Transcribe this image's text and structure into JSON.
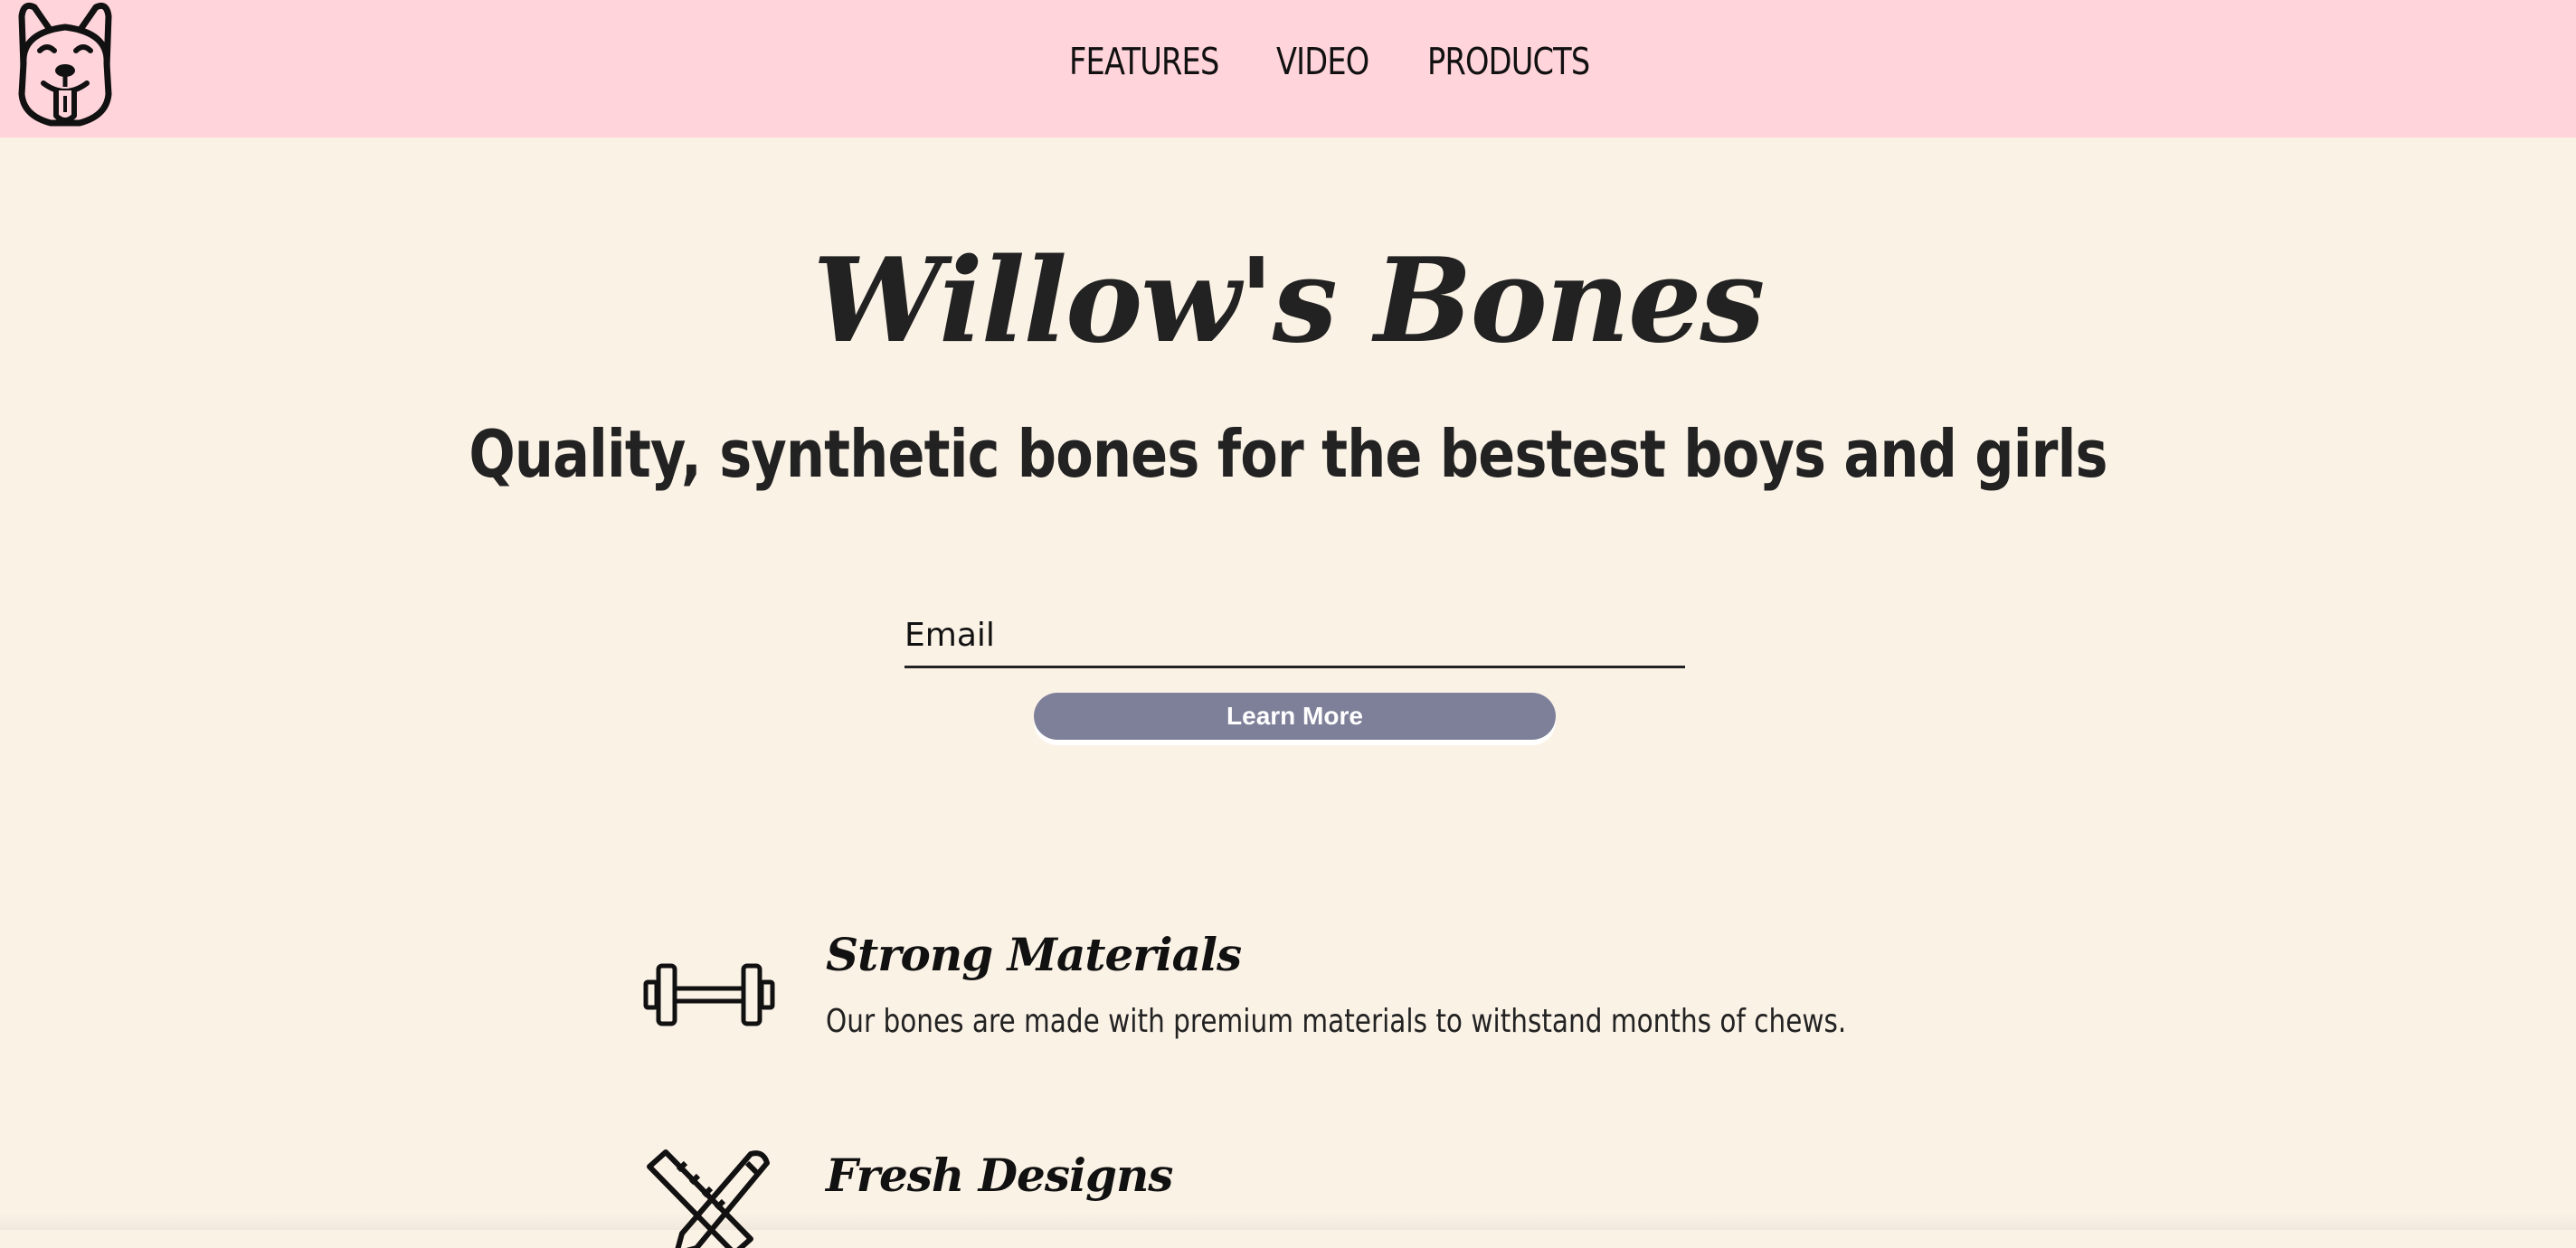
{
  "nav": {
    "logo_icon": "dog-face-icon",
    "links": [
      {
        "label": "FEATURES"
      },
      {
        "label": "VIDEO"
      },
      {
        "label": "PRODUCTS"
      }
    ]
  },
  "hero": {
    "title": "Willow's Bones",
    "subtitle": "Quality, synthetic bones for the bestest boys and girls"
  },
  "form": {
    "email_placeholder": "Email",
    "email_value": "",
    "submit_label": "Learn More"
  },
  "features": [
    {
      "icon": "dumbbell-icon",
      "title": "Strong Materials",
      "description": "Our bones are made with premium materials to withstand months of chews."
    },
    {
      "icon": "ruler-pencil-icon",
      "title": "Fresh Designs"
    }
  ],
  "colors": {
    "nav_background": "#ffd4db",
    "page_background": "#fbf2e6",
    "button_background": "#7e8099",
    "text": "#222222"
  }
}
